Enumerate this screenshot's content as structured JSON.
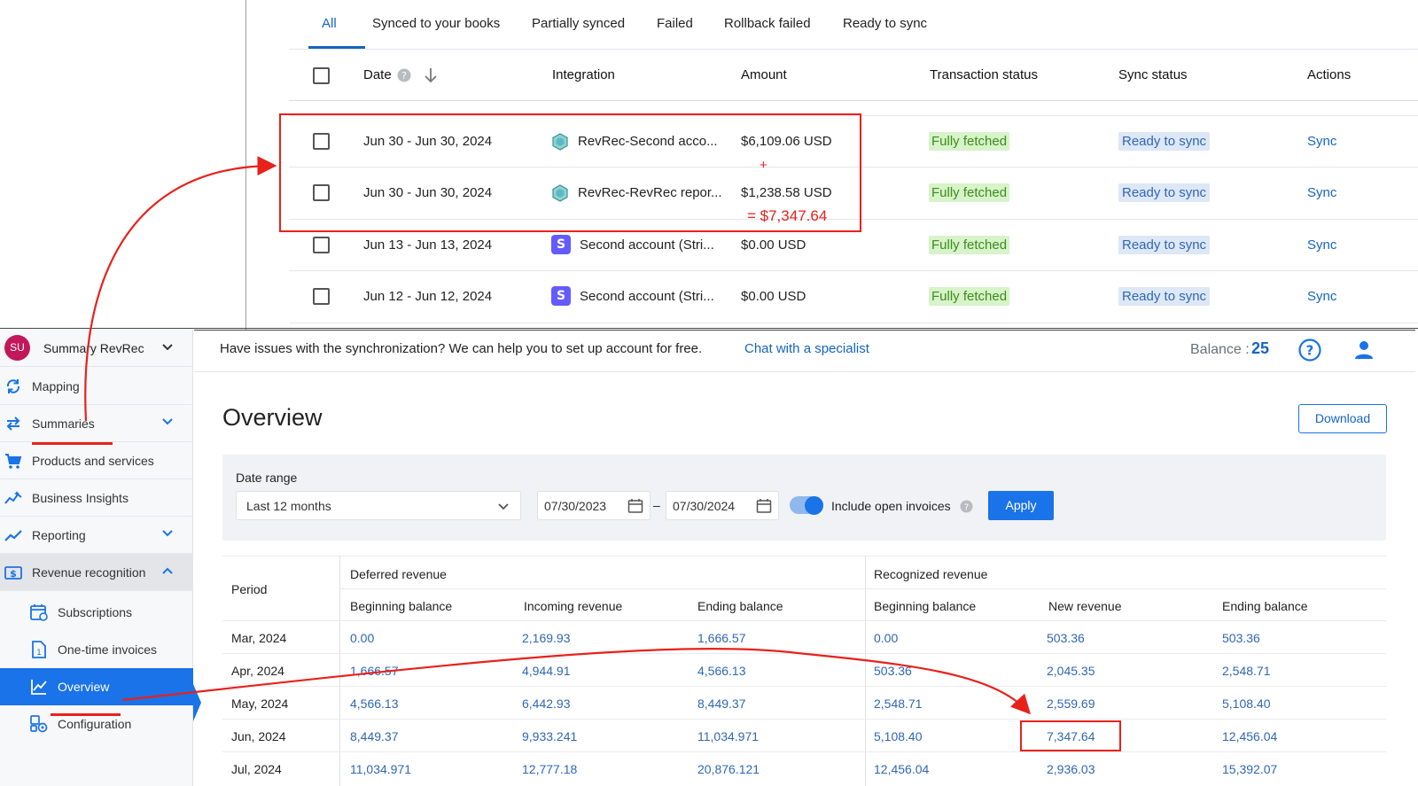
{
  "tabs": [
    {
      "label": "All",
      "active": true
    },
    {
      "label": "Synced to your books"
    },
    {
      "label": "Partially synced"
    },
    {
      "label": "Failed"
    },
    {
      "label": "Rollback failed"
    },
    {
      "label": "Ready to sync"
    }
  ],
  "table": {
    "headers": {
      "date": "Date",
      "integration": "Integration",
      "amount": "Amount",
      "transaction_status": "Transaction status",
      "sync_status": "Sync status",
      "actions": "Actions"
    },
    "rows": [
      {
        "date": "Jun 30 - Jun 30, 2024",
        "integration": "RevRec-Second acco...",
        "icon": "revrec-icon",
        "amount": "$6,109.06 USD",
        "tx_status": "Fully fetched",
        "sync_status": "Ready to sync",
        "action": "Sync"
      },
      {
        "date": "Jun 30 - Jun 30, 2024",
        "integration": "RevRec-RevRec repor...",
        "icon": "revrec-icon",
        "amount": "$1,238.58 USD",
        "tx_status": "Fully fetched",
        "sync_status": "Ready to sync",
        "action": "Sync"
      },
      {
        "date": "Jun 13 - Jun 13, 2024",
        "integration": "Second account (Stri...",
        "icon": "stripe-icon",
        "amount": "$0.00 USD",
        "tx_status": "Fully fetched",
        "sync_status": "Ready to sync",
        "action": "Sync"
      },
      {
        "date": "Jun 12 - Jun 12, 2024",
        "integration": "Second account (Stri...",
        "icon": "stripe-icon",
        "amount": "$0.00 USD",
        "tx_status": "Fully fetched",
        "sync_status": "Ready to sync",
        "action": "Sync"
      }
    ]
  },
  "annotation": {
    "plus": "+",
    "sum": "= $7,347.64"
  },
  "sidebar": {
    "account": {
      "initials": "SU",
      "name": "Summary RevRec"
    },
    "items": [
      {
        "label": "Mapping",
        "icon": "sync-icon"
      },
      {
        "label": "Summaries",
        "icon": "swap-arrows-icon"
      },
      {
        "label": "Products and services",
        "icon": "cart-icon"
      },
      {
        "label": "Business Insights",
        "icon": "insights-icon"
      },
      {
        "label": "Reporting",
        "icon": "chart-line-icon"
      },
      {
        "label": "Revenue recognition",
        "icon": "dollar-tag-icon"
      }
    ],
    "subitems": [
      {
        "label": "Subscriptions",
        "icon": "calendar-repeat-icon"
      },
      {
        "label": "One-time invoices",
        "icon": "invoice-icon"
      },
      {
        "label": "Overview",
        "icon": "overview-chart-icon",
        "active": true
      },
      {
        "label": "Configuration",
        "icon": "config-icon"
      }
    ]
  },
  "banner": {
    "text": "Have issues with the synchronization? We can help you to set up account for free.",
    "link": "Chat with a specialist",
    "balance_label": "Balance :",
    "balance_value": "25"
  },
  "overview": {
    "title": "Overview",
    "download": "Download",
    "filters": {
      "date_range_label": "Date range",
      "range_value": "Last 12 months",
      "from": "07/30/2023",
      "dash": "–",
      "to": "07/30/2024",
      "include_open_invoices": "Include open invoices",
      "include_open_invoices_on": true,
      "apply": "Apply"
    },
    "revenue_table": {
      "period_header": "Period",
      "deferred_group": "Deferred revenue",
      "recognized_group": "Recognized revenue",
      "deferred_cols": [
        "Beginning balance",
        "Incoming revenue",
        "Ending balance"
      ],
      "recognized_cols": [
        "Beginning balance",
        "New revenue",
        "Ending balance"
      ],
      "rows": [
        {
          "period": "Mar, 2024",
          "d_begin": "0.00",
          "d_in": "2,169.93",
          "d_end": "1,666.57",
          "r_begin": "0.00",
          "r_new": "503.36",
          "r_end": "503.36"
        },
        {
          "period": "Apr, 2024",
          "d_begin": "1,666.57",
          "d_in": "4,944.91",
          "d_end": "4,566.13",
          "r_begin": "503.36",
          "r_new": "2,045.35",
          "r_end": "2,548.71"
        },
        {
          "period": "May, 2024",
          "d_begin": "4,566.13",
          "d_in": "6,442.93",
          "d_end": "8,449.37",
          "r_begin": "2,548.71",
          "r_new": "2,559.69",
          "r_end": "5,108.40"
        },
        {
          "period": "Jun, 2024",
          "d_begin": "8,449.37",
          "d_in": "9,933.241",
          "d_end": "11,034.971",
          "r_begin": "5,108.40",
          "r_new": "7,347.64",
          "r_end": "12,456.04"
        },
        {
          "period": "Jul, 2024",
          "d_begin": "11,034.971",
          "d_in": "12,777.18",
          "d_end": "20,876.121",
          "r_begin": "12,456.04",
          "r_new": "2,936.03",
          "r_end": "15,392.07"
        }
      ]
    }
  },
  "colors": {
    "accent": "#1a73e8",
    "annotation_red": "#e8211b",
    "fully_fetched_bg": "#d7f3c9",
    "ready_to_sync_bg": "#dde7f6"
  }
}
